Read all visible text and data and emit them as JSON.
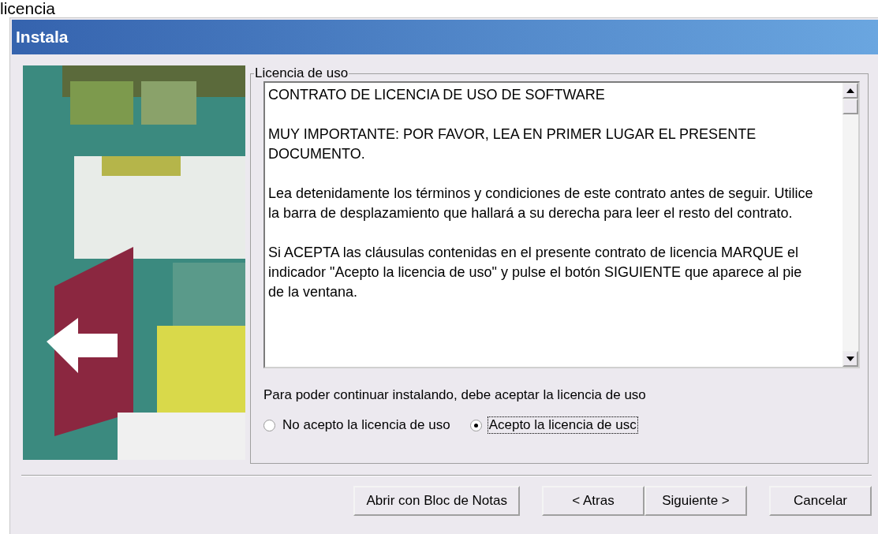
{
  "caption_above": "licencia",
  "window": {
    "title": "Instala"
  },
  "license_group": {
    "legend": "Licencia de uso",
    "paragraphs": [
      "CONTRATO DE LICENCIA DE USO DE SOFTWARE",
      "MUY IMPORTANTE: POR FAVOR, LEA EN PRIMER LUGAR EL PRESENTE DOCUMENTO.",
      "Lea detenidamente los términos y condiciones de este contrato antes de seguir. Utilice la barra de desplazamiento que hallará a su derecha para leer el resto del contrato.",
      "Si ACEPTA las cláusulas contenidas en el presente contrato de licencia MARQUE el indicador \"Acepto la licencia de uso\" y pulse el botón SIGUIENTE que aparece al pie de la ventana."
    ],
    "instruction": "Para poder continuar instalando, debe aceptar la licencia de uso",
    "options": [
      {
        "label": "No acepto la licencia de uso",
        "selected": false
      },
      {
        "label": "Acepto la licencia de usc",
        "selected": true
      }
    ]
  },
  "buttons": [
    {
      "label": "Abrir con Bloc de Notas"
    },
    {
      "label": "< Atras"
    },
    {
      "label": "Siguiente >"
    },
    {
      "label": "Cancelar"
    }
  ]
}
